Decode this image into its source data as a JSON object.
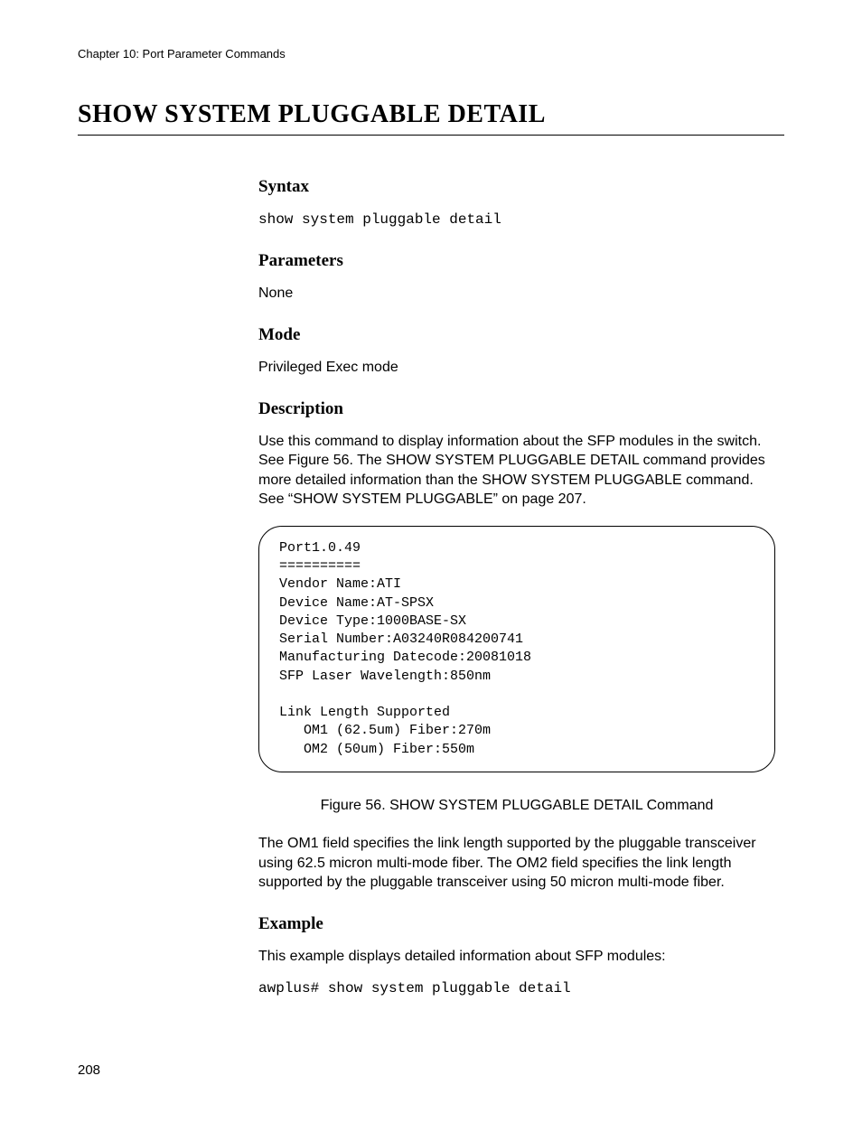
{
  "running_head": "Chapter 10: Port Parameter Commands",
  "title": "SHOW SYSTEM PLUGGABLE DETAIL",
  "sections": {
    "syntax": {
      "heading": "Syntax",
      "code": "show system pluggable detail"
    },
    "parameters": {
      "heading": "Parameters",
      "text": "None"
    },
    "mode": {
      "heading": "Mode",
      "text": "Privileged Exec mode"
    },
    "description": {
      "heading": "Description",
      "text": "Use this command to display information about the SFP modules in the switch. See Figure 56. The SHOW SYSTEM PLUGGABLE DETAIL command provides more detailed information than the SHOW SYSTEM PLUGGABLE command. See “SHOW SYSTEM PLUGGABLE” on page 207.",
      "figure_code": "Port1.0.49\n==========\nVendor Name:ATI\nDevice Name:AT-SPSX\nDevice Type:1000BASE-SX\nSerial Number:A03240R084200741\nManufacturing Datecode:20081018\nSFP Laser Wavelength:850nm\n\nLink Length Supported\n   OM1 (62.5um) Fiber:270m\n   OM2 (50um) Fiber:550m",
      "figure_caption": "Figure 56. SHOW SYSTEM PLUGGABLE DETAIL Command",
      "text2": "The OM1 field specifies the link length supported by the pluggable transceiver using 62.5 micron multi-mode fiber. The OM2 field specifies the link length supported by the pluggable transceiver using 50 micron multi-mode fiber."
    },
    "example": {
      "heading": "Example",
      "text": "This example displays detailed information about SFP modules:",
      "code": "awplus# show system pluggable detail"
    }
  },
  "page_number": "208"
}
